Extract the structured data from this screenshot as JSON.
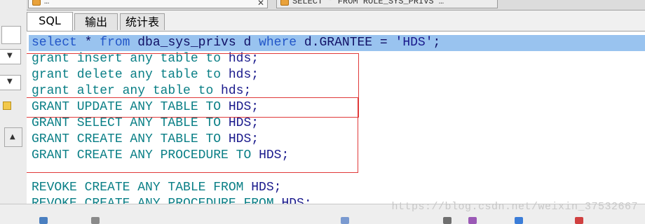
{
  "window_tabs": [
    {
      "label": "…",
      "active": true
    },
    {
      "label": "SELECT * FROM ROLE_SYS_PRIVS …",
      "active": false
    }
  ],
  "sub_tabs": [
    "SQL",
    "输出",
    "统计表"
  ],
  "editor": {
    "lines": [
      {
        "selected": true,
        "tokens": [
          {
            "k": "kw",
            "t": "select"
          },
          {
            "k": "txt",
            "t": " * "
          },
          {
            "k": "kw",
            "t": "from"
          },
          {
            "k": "txt",
            "t": " dba_sys_privs d "
          },
          {
            "k": "kw",
            "t": "where"
          },
          {
            "k": "txt",
            "t": " d.GRANTEE = "
          },
          {
            "k": "str",
            "t": "'HDS'"
          },
          {
            "k": "txt",
            "t": ";"
          }
        ]
      },
      {
        "tokens": [
          {
            "k": "kw",
            "t": "grant insert any table to"
          },
          {
            "k": "txt",
            "t": " hds;"
          }
        ]
      },
      {
        "tokens": [
          {
            "k": "kw",
            "t": "grant delete any table to"
          },
          {
            "k": "txt",
            "t": " hds;"
          }
        ]
      },
      {
        "tokens": [
          {
            "k": "kw",
            "t": "grant alter any table to"
          },
          {
            "k": "txt",
            "t": " hds;"
          }
        ]
      },
      {
        "tokens": [
          {
            "k": "kw",
            "t": "GRANT UPDATE ANY TABLE TO"
          },
          {
            "k": "txt",
            "t": " HDS;"
          }
        ]
      },
      {
        "tokens": [
          {
            "k": "kw",
            "t": "GRANT SELECT ANY TABLE TO"
          },
          {
            "k": "txt",
            "t": " HDS;"
          }
        ]
      },
      {
        "tokens": [
          {
            "k": "kw",
            "t": "GRANT CREATE ANY TABLE TO"
          },
          {
            "k": "txt",
            "t": " HDS;"
          }
        ]
      },
      {
        "tokens": [
          {
            "k": "kw",
            "t": "GRANT CREATE ANY PROCEDURE TO"
          },
          {
            "k": "txt",
            "t": " HDS;"
          }
        ]
      },
      {
        "tokens": []
      },
      {
        "tokens": [
          {
            "k": "kw",
            "t": "REVOKE CREATE ANY TABLE FROM"
          },
          {
            "k": "txt",
            "t": " HDS;"
          }
        ]
      },
      {
        "tokens": [
          {
            "k": "kw",
            "t": "REVOKE CREATE ANY PROCEDURE FROM"
          },
          {
            "k": "txt",
            "t": " HDS;"
          }
        ]
      }
    ]
  },
  "watermark": "https://blog.csdn.net/weixin_37532667",
  "colors": {
    "selection": "#99c3ef",
    "keyword": "#0a7f86",
    "identifier": "#1a1a8c",
    "highlight_box": "#e03a3a"
  }
}
